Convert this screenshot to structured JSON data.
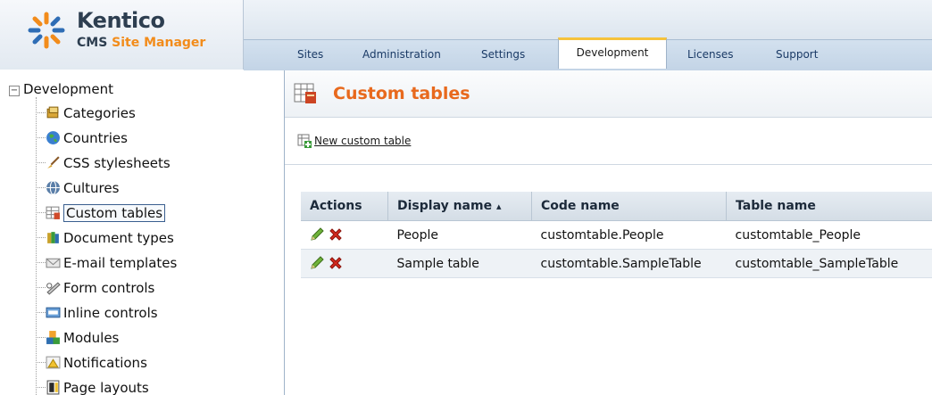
{
  "brand": {
    "name": "Kentico",
    "product_prefix": "CMS",
    "product_accent": "Site Manager"
  },
  "tabs": {
    "sites": "Sites",
    "administration": "Administration",
    "settings": "Settings",
    "development": "Development",
    "licenses": "Licenses",
    "support": "Support",
    "active": "Development"
  },
  "tree": {
    "root": "Development",
    "items": [
      {
        "label": "Categories",
        "icon": "categories-icon"
      },
      {
        "label": "Countries",
        "icon": "globe-icon"
      },
      {
        "label": "CSS stylesheets",
        "icon": "brush-icon"
      },
      {
        "label": "Cultures",
        "icon": "culture-globe-icon"
      },
      {
        "label": "Custom tables",
        "icon": "custom-table-icon",
        "selected": true
      },
      {
        "label": "Document types",
        "icon": "document-types-icon"
      },
      {
        "label": "E-mail templates",
        "icon": "email-template-icon"
      },
      {
        "label": "Form controls",
        "icon": "form-controls-icon"
      },
      {
        "label": "Inline controls",
        "icon": "inline-controls-icon"
      },
      {
        "label": "Modules",
        "icon": "modules-icon"
      },
      {
        "label": "Notifications",
        "icon": "notifications-icon"
      },
      {
        "label": "Page layouts",
        "icon": "page-layouts-icon"
      }
    ]
  },
  "page": {
    "title": "Custom tables",
    "new_link": "New custom table"
  },
  "grid": {
    "headers": {
      "actions": "Actions",
      "display_name": "Display name",
      "sort_indicator": "▴",
      "code_name": "Code name",
      "table_name": "Table name"
    },
    "rows": [
      {
        "display_name": "People",
        "code_name": "customtable.People",
        "table_name": "customtable_People"
      },
      {
        "display_name": "Sample table",
        "code_name": "customtable.SampleTable",
        "table_name": "customtable_SampleTable"
      }
    ]
  },
  "colors": {
    "title_orange": "#e8691d",
    "tab_active_accent": "#f6c33b",
    "tabbar_blue": "#c3d4e6"
  }
}
